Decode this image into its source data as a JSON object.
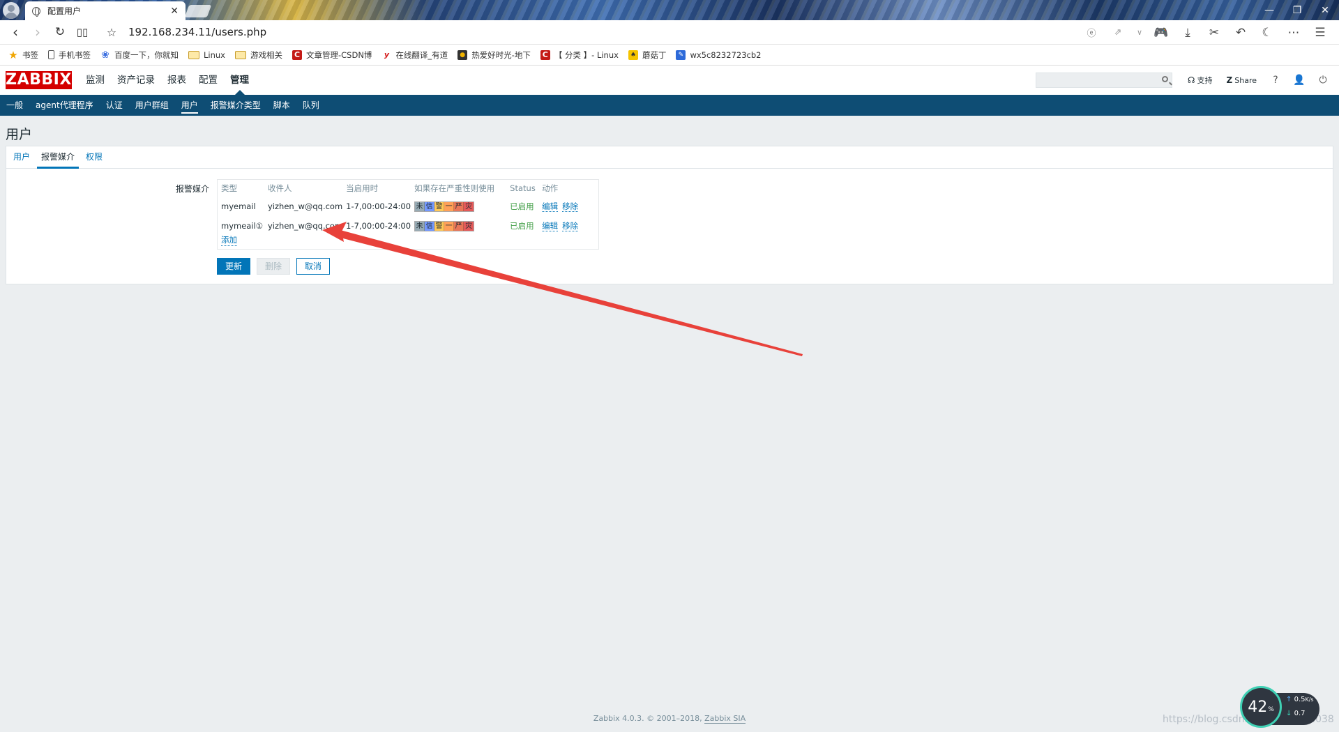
{
  "browser": {
    "tab_title": "配置用户",
    "url": "192.168.234.11/users.php",
    "bookmarks": [
      {
        "label": "书签",
        "icon": "star-icon"
      },
      {
        "label": "手机书签",
        "icon": "phone-icon"
      },
      {
        "label": "百度一下，你就知",
        "icon": "baidu-paw-icon"
      },
      {
        "label": "Linux",
        "icon": "folder-icon"
      },
      {
        "label": "游戏相关",
        "icon": "folder-icon"
      },
      {
        "label": "文章管理-CSDN博",
        "icon": "csdn-icon"
      },
      {
        "label": "在线翻译_有道",
        "icon": "youdao-icon"
      },
      {
        "label": "热爱好时光-地下",
        "icon": "tiger-icon"
      },
      {
        "label": "【 分类 】- Linux",
        "icon": "csdn-icon"
      },
      {
        "label": "蘑菇丁",
        "icon": "mogu-icon"
      },
      {
        "label": "wx5c8232723cb2",
        "icon": "edit-icon"
      }
    ]
  },
  "zabbix": {
    "logo": "ZABBIX",
    "main_menu": [
      "监测",
      "资产记录",
      "报表",
      "配置",
      "管理"
    ],
    "main_menu_selected": "管理",
    "header_links": {
      "support": "支持",
      "share": "Share"
    },
    "sub_menu": [
      "一般",
      "agent代理程序",
      "认证",
      "用户群组",
      "用户",
      "报警媒介类型",
      "脚本",
      "队列"
    ],
    "sub_menu_selected": "用户"
  },
  "page": {
    "title": "用户",
    "tabs": [
      "用户",
      "报警媒介",
      "权限"
    ],
    "active_tab": "报警媒介",
    "form_label": "报警媒介",
    "media_table": {
      "headers": [
        "类型",
        "收件人",
        "当启用时",
        "如果存在严重性则使用",
        "Status",
        "动作"
      ],
      "rows": [
        {
          "type": "myemail",
          "sendto": "yizhen_w@qq.com",
          "period": "1-7,00:00-24:00",
          "status": "已启用",
          "edit": "编辑",
          "remove": "移除"
        },
        {
          "type": "mymeail①",
          "sendto": "yizhen_w@qq.com",
          "period": "1-7,00:00-24:00",
          "status": "已启用",
          "edit": "编辑",
          "remove": "移除"
        }
      ],
      "severity": [
        {
          "label": "未",
          "color": "#97aab3"
        },
        {
          "label": "信",
          "color": "#7499ff"
        },
        {
          "label": "警",
          "color": "#ffc859"
        },
        {
          "label": "一",
          "color": "#ffa059"
        },
        {
          "label": "严",
          "color": "#e97659"
        },
        {
          "label": "灾",
          "color": "#e45959"
        }
      ],
      "add_label": "添加"
    },
    "buttons": {
      "update": "更新",
      "delete": "删除",
      "cancel": "取消"
    }
  },
  "footer": {
    "text": "Zabbix 4.0.3. © 2001–2018,",
    "link": "Zabbix SIA"
  },
  "overlay": {
    "watermark": "https://blog.csdn.net/qq_41832038",
    "speed_percent": "42",
    "upload": "0.5",
    "upload_unit": "K/s",
    "download": "0.7"
  },
  "colors": {
    "zabbix_red": "#d40000",
    "submenu_bg": "#0e4d74",
    "link_blue": "#0275b8",
    "annotation_arrow": "#e8413a"
  }
}
